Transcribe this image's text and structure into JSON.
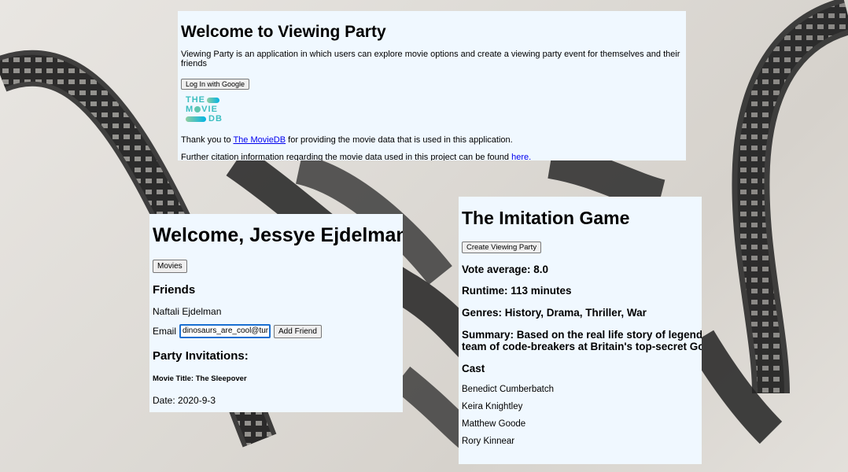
{
  "intro": {
    "title": "Welcome to Viewing Party",
    "description": "Viewing Party is an application in which users can explore movie options and create a viewing party event for themselves and their friends",
    "login_label": "Log In with Google",
    "tmdb_logo": {
      "line1": "THE",
      "line2_a": "M",
      "line2_b": "VIE",
      "line3": "DB"
    },
    "thanks_prefix": "Thank you to ",
    "thanks_link": "The MovieDB",
    "thanks_suffix": " for providing the movie data that is used in this application.",
    "citation_prefix": "Further citation information regarding the movie data used in this project can be found ",
    "citation_link": "here."
  },
  "dashboard": {
    "title": "Welcome, Jessye Ejdelman",
    "movies_label": "Movies",
    "friends_heading": "Friends",
    "friends": [
      "Naftali Ejdelman"
    ],
    "email_label": "Email",
    "email_value": "dinosaurs_are_cool@tur",
    "add_friend_label": "Add Friend",
    "invitations_heading": "Party Invitations:",
    "invitation_movie": "Movie Title: The Sleepover",
    "invitation_date": "Date: 2020-9-3"
  },
  "movie": {
    "title": "The Imitation Game",
    "create_label": "Create Viewing Party",
    "vote": "Vote average: 8.0",
    "runtime": "Runtime: 113 minutes",
    "genres": "Genres: History, Drama, Thriller, War",
    "summary_line1": "Summary: Based on the real life story of legenda",
    "summary_line2": "team of code-breakers at Britain's top-secret Gov",
    "cast_heading": "Cast",
    "cast": [
      "Benedict Cumberbatch",
      "Keira Knightley",
      "Matthew Goode",
      "Rory Kinnear"
    ]
  }
}
